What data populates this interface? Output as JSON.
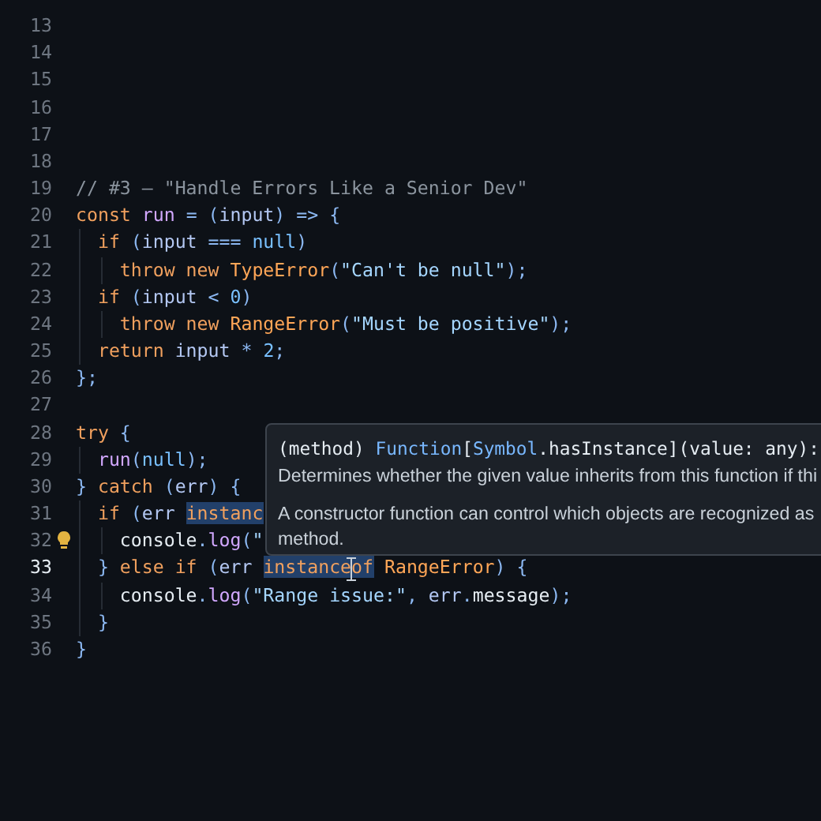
{
  "lines": [
    {
      "number": "13",
      "active": false
    },
    {
      "number": "14",
      "active": false
    },
    {
      "number": "15",
      "active": false
    },
    {
      "number": "16",
      "active": false
    },
    {
      "number": "17",
      "active": false
    },
    {
      "number": "18",
      "active": false
    },
    {
      "number": "19",
      "active": false,
      "tokens": [
        {
          "text": "// #3 — \"Handle Errors Like a Senior Dev\"",
          "kind": "comment"
        }
      ]
    },
    {
      "number": "20",
      "active": false,
      "tokens": [
        {
          "text": "const ",
          "kind": "keyword"
        },
        {
          "text": "run",
          "kind": "function"
        },
        {
          "text": " = (",
          "kind": "punct"
        },
        {
          "text": "input",
          "kind": "variable"
        },
        {
          "text": ") => {",
          "kind": "punct"
        }
      ]
    },
    {
      "number": "21",
      "active": false,
      "tokens": [
        {
          "text": "  if",
          "kind": "keyword"
        },
        {
          "text": " (",
          "kind": "punct"
        },
        {
          "text": "input",
          "kind": "variable"
        },
        {
          "text": " === ",
          "kind": "punct"
        },
        {
          "text": "null",
          "kind": "constant"
        },
        {
          "text": ")",
          "kind": "punct"
        }
      ]
    },
    {
      "number": "22",
      "active": false,
      "tokens": [
        {
          "text": "    throw new ",
          "kind": "keyword"
        },
        {
          "text": "TypeError",
          "kind": "class"
        },
        {
          "text": "(",
          "kind": "punct"
        },
        {
          "text": "\"Can't be null\"",
          "kind": "string"
        },
        {
          "text": ");",
          "kind": "punct"
        }
      ]
    },
    {
      "number": "23",
      "active": false,
      "tokens": [
        {
          "text": "  if",
          "kind": "keyword"
        },
        {
          "text": " (",
          "kind": "punct"
        },
        {
          "text": "input",
          "kind": "variable"
        },
        {
          "text": " < ",
          "kind": "punct"
        },
        {
          "text": "0",
          "kind": "constant"
        },
        {
          "text": ")",
          "kind": "punct"
        }
      ]
    },
    {
      "number": "24",
      "active": false,
      "tokens": [
        {
          "text": "    throw new ",
          "kind": "keyword"
        },
        {
          "text": "RangeError",
          "kind": "class"
        },
        {
          "text": "(",
          "kind": "punct"
        },
        {
          "text": "\"Must be positive\"",
          "kind": "string"
        },
        {
          "text": ");",
          "kind": "punct"
        }
      ]
    },
    {
      "number": "25",
      "active": false,
      "tokens": [
        {
          "text": "  return ",
          "kind": "keyword"
        },
        {
          "text": "input",
          "kind": "variable"
        },
        {
          "text": " * ",
          "kind": "punct"
        },
        {
          "text": "2",
          "kind": "constant"
        },
        {
          "text": ";",
          "kind": "punct"
        }
      ]
    },
    {
      "number": "26",
      "active": false,
      "tokens": [
        {
          "text": "};",
          "kind": "punct"
        }
      ]
    },
    {
      "number": "27",
      "active": false
    },
    {
      "number": "28",
      "active": false,
      "tokens": [
        {
          "text": "try",
          "kind": "keyword"
        },
        {
          "text": " {",
          "kind": "punct"
        }
      ]
    },
    {
      "number": "29",
      "active": false,
      "tokens": [
        {
          "text": "  run",
          "kind": "function"
        },
        {
          "text": "(",
          "kind": "punct"
        },
        {
          "text": "null",
          "kind": "constant"
        },
        {
          "text": ");",
          "kind": "punct"
        }
      ]
    },
    {
      "number": "30",
      "active": false,
      "tokens": [
        {
          "text": "} ",
          "kind": "punct"
        },
        {
          "text": "catch",
          "kind": "keyword"
        },
        {
          "text": " (",
          "kind": "punct"
        },
        {
          "text": "err",
          "kind": "variable"
        },
        {
          "text": ") {",
          "kind": "punct"
        }
      ]
    },
    {
      "number": "31",
      "active": false,
      "tokens": [
        {
          "text": "  if",
          "kind": "keyword"
        },
        {
          "text": " (",
          "kind": "punct"
        },
        {
          "text": "err ",
          "kind": "variable"
        },
        {
          "text": "instanc",
          "kind": "keyword",
          "highlighted": true
        }
      ]
    },
    {
      "number": "32",
      "active": false,
      "lightbulb": true,
      "tokens": [
        {
          "text": "    console",
          "kind": "plain"
        },
        {
          "text": ".",
          "kind": "punct"
        },
        {
          "text": "log",
          "kind": "function"
        },
        {
          "text": "(",
          "kind": "punct"
        },
        {
          "text": "\"",
          "kind": "string"
        }
      ]
    },
    {
      "number": "33",
      "active": true,
      "cursor": true,
      "tokens": [
        {
          "text": "  } ",
          "kind": "punct"
        },
        {
          "text": "else if",
          "kind": "keyword"
        },
        {
          "text": " (",
          "kind": "punct"
        },
        {
          "text": "err ",
          "kind": "variable"
        },
        {
          "text": "instanceof",
          "kind": "keyword",
          "highlighted": true
        },
        {
          "text": " RangeError",
          "kind": "class"
        },
        {
          "text": ") {",
          "kind": "punct"
        }
      ]
    },
    {
      "number": "34",
      "active": false,
      "tokens": [
        {
          "text": "    console",
          "kind": "plain"
        },
        {
          "text": ".",
          "kind": "punct"
        },
        {
          "text": "log",
          "kind": "function"
        },
        {
          "text": "(",
          "kind": "punct"
        },
        {
          "text": "\"Range issue:\"",
          "kind": "string"
        },
        {
          "text": ", ",
          "kind": "punct"
        },
        {
          "text": "err",
          "kind": "variable"
        },
        {
          "text": ".",
          "kind": "punct"
        },
        {
          "text": "message",
          "kind": "plain"
        },
        {
          "text": ");",
          "kind": "punct"
        }
      ]
    },
    {
      "number": "35",
      "active": false,
      "tokens": [
        {
          "text": "  }",
          "kind": "punct"
        }
      ]
    },
    {
      "number": "36",
      "active": false,
      "tokens": [
        {
          "text": "}",
          "kind": "punct"
        }
      ]
    }
  ],
  "tooltip": {
    "signature": [
      {
        "text": "(method) ",
        "kind": "plain"
      },
      {
        "text": "Function",
        "kind": "type"
      },
      {
        "text": "[",
        "kind": "plain"
      },
      {
        "text": "Symbol",
        "kind": "type"
      },
      {
        "text": ".hasInstance](value: any):",
        "kind": "plain"
      }
    ],
    "paragraphs": [
      "Determines whether the given value inherits from this function if thi",
      "A constructor function can control which objects are recognized as",
      "method."
    ]
  }
}
